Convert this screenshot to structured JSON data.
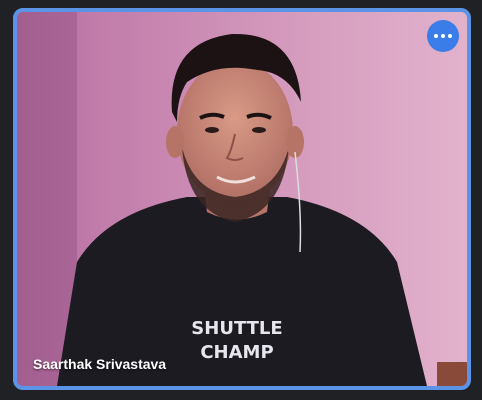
{
  "participant": {
    "name": "Saarthak Srivastava",
    "shirt_text_line1": "SHUTTLE",
    "shirt_text_line2": "CHAMP"
  },
  "controls": {
    "more_options_icon": "more-horizontal-icon"
  },
  "colors": {
    "active_speaker_border": "#5b93e6",
    "more_button_bg": "#3b7de8",
    "background": "#202124"
  }
}
